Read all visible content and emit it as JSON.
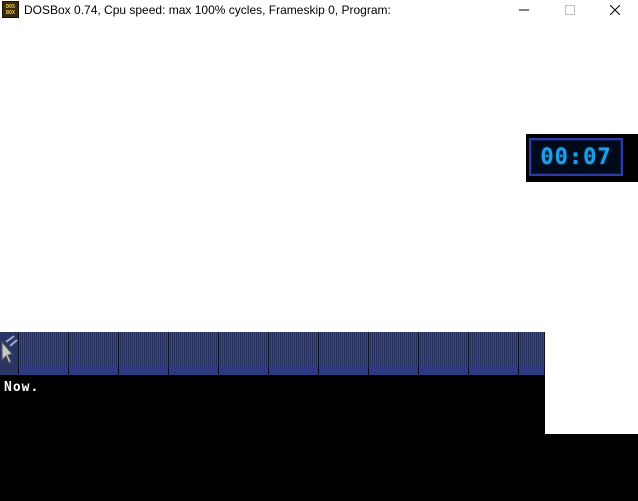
{
  "window": {
    "title": "DOSBox 0.74, Cpu speed: max 100% cycles, Frameskip  0, Program:",
    "icon": "dosbox-icon",
    "icon_text_top": "DOS",
    "icon_text_bottom": "BOX",
    "controls": {
      "minimize_icon": "minimize-icon",
      "maximize_icon": "maximize-icon",
      "close_icon": "close-icon"
    }
  },
  "game": {
    "timer": "00:07",
    "timer_color": "#1ea0e6",
    "timer_border_color": "#2e3aa8",
    "toolbar": {
      "slots": 11,
      "cursor_icon": "arrow-cursor-icon"
    },
    "message": "Now."
  }
}
